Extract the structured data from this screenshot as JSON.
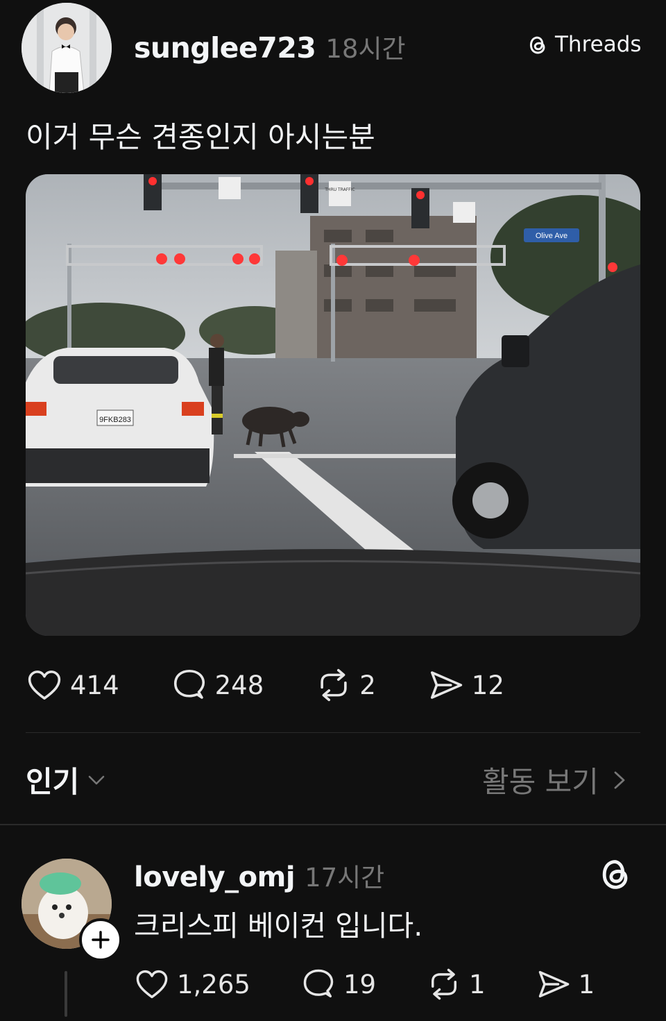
{
  "post": {
    "username": "sunglee723",
    "time": "18시간",
    "badge_label": "Threads",
    "text": "이거 무슨 견종인지 아시는분",
    "photo_signs": {
      "street": "Olive Ave",
      "plate": "9FKB283",
      "thru_traffic": "THRU TRAFFIC"
    },
    "stats": {
      "likes": "414",
      "comments": "248",
      "reposts": "2",
      "shares": "12"
    }
  },
  "sort": {
    "label": "인기",
    "activity_label": "활동 보기"
  },
  "reply": {
    "username": "lovely_omj",
    "time": "17시간",
    "text": "크리스피 베이컨 입니다.",
    "stats": {
      "likes": "1,265",
      "comments": "19",
      "reposts": "1",
      "shares": "1"
    }
  },
  "icons": {
    "like": "heart-icon",
    "comment": "comment-icon",
    "repost": "repost-icon",
    "share": "share-icon",
    "threads": "threads-logo-icon",
    "chevron_down": "chevron-down-icon",
    "chevron_right": "chevron-right-icon",
    "follow": "plus-icon"
  },
  "colors": {
    "background": "#101010",
    "text": "#f3f5f7",
    "muted": "#777777",
    "divider": "#2a2a2a"
  }
}
